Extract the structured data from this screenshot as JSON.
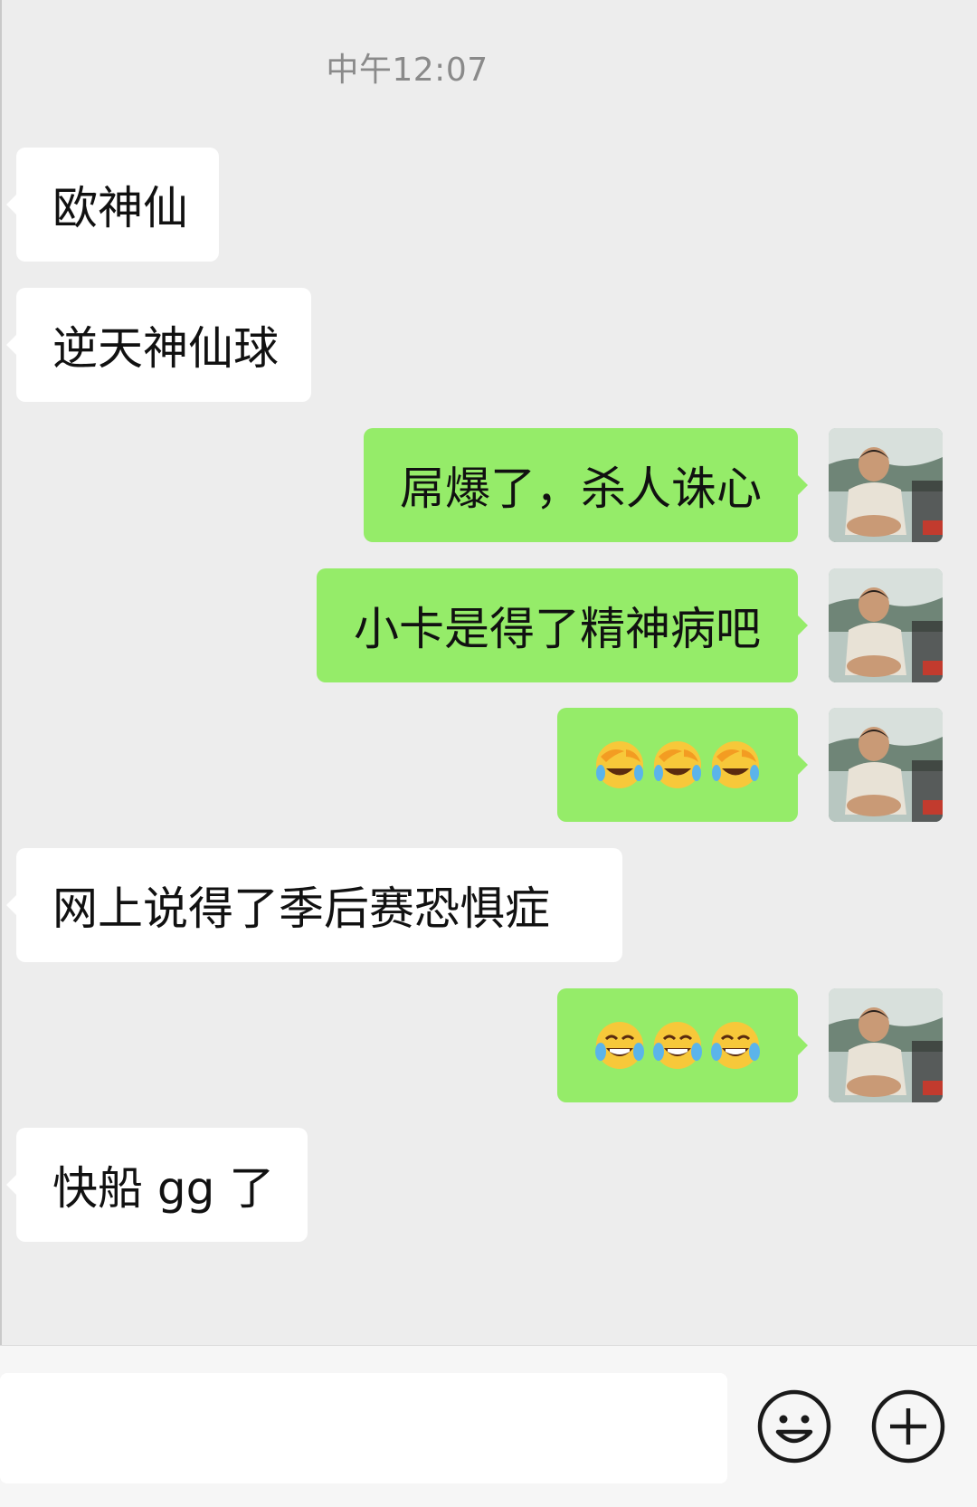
{
  "timestamp": "中午12:07",
  "messages": [
    {
      "side": "in",
      "text": "欧神仙"
    },
    {
      "side": "in",
      "text": "逆天神仙球"
    },
    {
      "side": "out",
      "text": "屌爆了，杀人诛心"
    },
    {
      "side": "out",
      "text": "小卡是得了精神病吧"
    },
    {
      "side": "out",
      "emoji": [
        "face-palm-laugh-emoji",
        "face-palm-laugh-emoji",
        "face-palm-laugh-emoji"
      ]
    },
    {
      "side": "in",
      "text": "网上说得了季后赛恐惧症"
    },
    {
      "side": "out",
      "emoji": [
        "tears-of-joy-emoji",
        "tears-of-joy-emoji",
        "tears-of-joy-emoji"
      ]
    },
    {
      "side": "in",
      "text": "快船 gg 了"
    }
  ],
  "input": {
    "value": "",
    "placeholder": ""
  },
  "icons": {
    "emoji_button": "smiley-icon",
    "more_button": "plus-icon"
  },
  "colors": {
    "background": "#ededed",
    "incoming_bubble": "#ffffff",
    "outgoing_bubble": "#95ec69",
    "timestamp_text": "#8a8a8a"
  }
}
